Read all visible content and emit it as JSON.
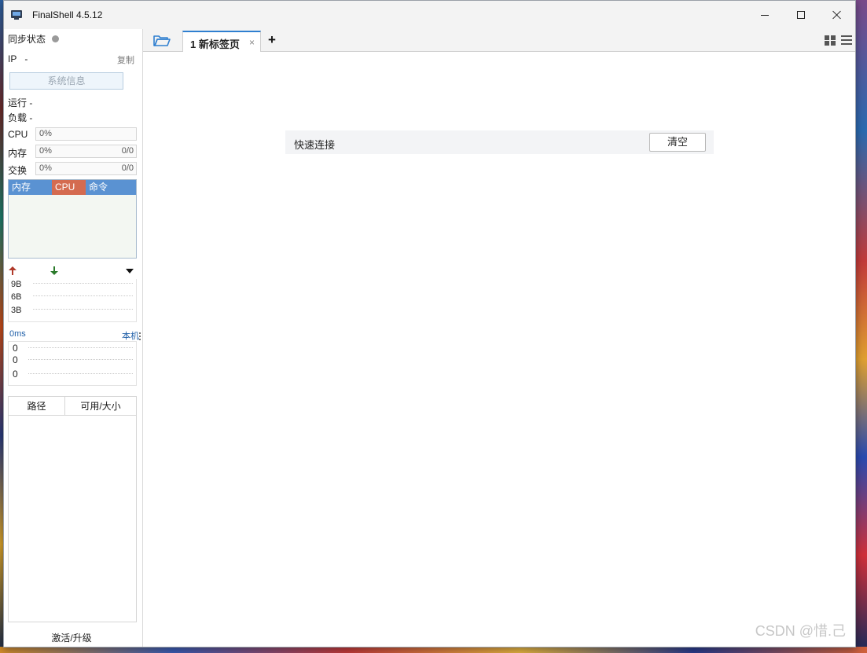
{
  "window": {
    "title": "FinalShell 4.5.12"
  },
  "left_panel": {
    "sync_label": "同步状态",
    "ip_label": "IP",
    "ip_value": "-",
    "copy_label": "复制",
    "sysinfo_button": "系统信息",
    "running_label": "运行 -",
    "load_label": "负载 -",
    "meters": [
      {
        "label": "CPU",
        "percent": "0%",
        "fraction": ""
      },
      {
        "label": "内存",
        "percent": "0%",
        "fraction": "0/0"
      },
      {
        "label": "交换",
        "percent": "0%",
        "fraction": "0/0"
      }
    ],
    "process_columns": {
      "memory": "内存",
      "cpu": "CPU",
      "command": "命令"
    },
    "net_graph_labels": [
      "9B",
      "6B",
      "3B"
    ],
    "ping_label": "0ms",
    "host_label": "本机",
    "ping_graph_labels": [
      "0",
      "0",
      "0"
    ],
    "disk_columns": {
      "path": "路径",
      "available": "可用/大小"
    },
    "activate_label": "激活/升级"
  },
  "tabs": [
    {
      "label": "1 新标签页",
      "close": "×"
    }
  ],
  "tab_add": "+",
  "quick_connect": {
    "label": "快速连接",
    "clear_button": "清空"
  },
  "watermark": "CSDN @惜.己",
  "colors": {
    "accent": "#2f7fd0",
    "memory_header": "#5a92d2",
    "cpu_header": "#d46b50",
    "upload_arrow": "#b03a2a",
    "download_arrow": "#2a7a2a",
    "link": "#1f5fa8"
  }
}
